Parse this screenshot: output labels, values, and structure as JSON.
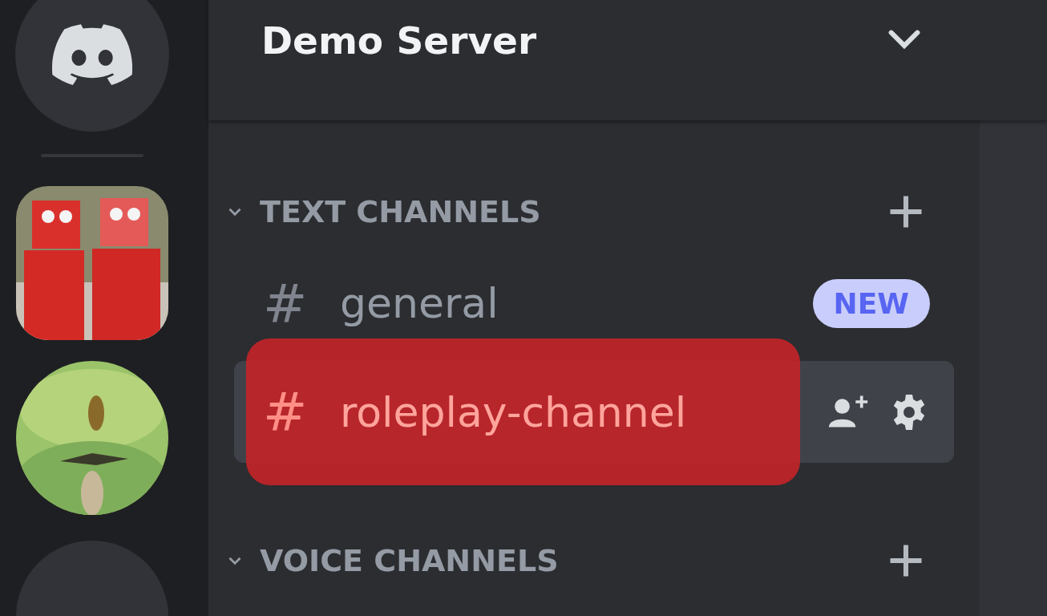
{
  "server_rail": {
    "servers": [
      {
        "kind": "home"
      },
      {
        "kind": "tile"
      },
      {
        "kind": "avatar"
      },
      {
        "kind": "blank"
      }
    ]
  },
  "server_header": {
    "title": "Demo Server",
    "expanded": false
  },
  "categories": [
    {
      "name": "TEXT CHANNELS",
      "expanded": true,
      "channels": [
        {
          "icon": "#",
          "name": "general",
          "selected": false,
          "highlighted": false,
          "badge": "NEW"
        },
        {
          "icon": "#",
          "name": "roleplay-channel",
          "selected": true,
          "highlighted": true
        }
      ]
    },
    {
      "name": "VOICE CHANNELS",
      "expanded": true
    }
  ]
}
